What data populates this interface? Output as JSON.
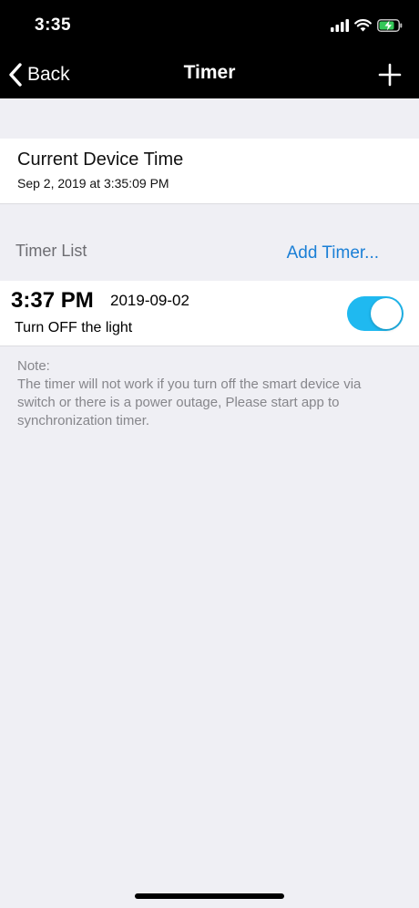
{
  "status_bar": {
    "time": "3:35",
    "icons": [
      "cellular-signal-icon",
      "wifi-icon",
      "battery-charging-icon"
    ]
  },
  "nav": {
    "back_label": "Back",
    "title": "Timer",
    "add_icon": "plus-icon"
  },
  "device_time": {
    "title": "Current Device Time",
    "value": "Sep 2, 2019 at 3:35:09 PM"
  },
  "timer_list": {
    "title": "Timer List",
    "add_link": "Add Timer...",
    "items": [
      {
        "time": "3:37 PM",
        "date": "2019-09-02",
        "action": "Turn OFF the light",
        "enabled": true
      }
    ]
  },
  "note": {
    "label": "Note:",
    "text": "The timer will not work if you turn off the smart device via switch or there is a power outage, Please start app to synchronization timer."
  },
  "colors": {
    "accent_link": "#1a7fd6",
    "toggle_on": "#1fb9f0",
    "background": "#efeff4",
    "nav_background": "#000000"
  }
}
